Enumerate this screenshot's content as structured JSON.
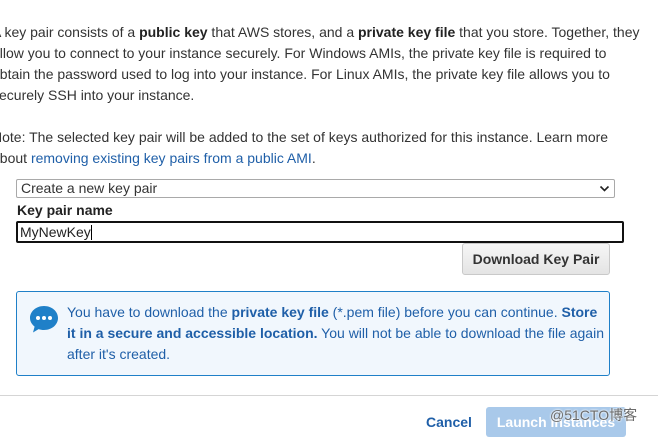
{
  "intro": {
    "l1_a": "A key pair consists of a ",
    "l1_b": "public key",
    "l1_c": " that AWS stores, and a ",
    "l1_d": "private key file",
    "l1_e": " that you store. Together, they",
    "l2": "allow you to connect to your instance securely. For Windows AMIs, the private key file is required to",
    "l3": "obtain the password used to log into your instance. For Linux AMIs, the private key file allows you to",
    "l4": "securely SSH into your instance."
  },
  "note": {
    "l1": "Note: The selected key pair will be added to the set of keys authorized for this instance. Learn more",
    "l2_a": "about ",
    "link": "removing existing key pairs from a public AMI",
    "l2_c": "."
  },
  "key_select": {
    "selected": "Create a new key pair",
    "icon": "chevron-down-icon"
  },
  "key_name": {
    "label": "Key pair name",
    "value": "MyNewKey"
  },
  "download_button": "Download Key Pair",
  "alert": {
    "icon": "speech-bubble-icon",
    "color": "#1f80c8",
    "t1": "You have to download the ",
    "t2": "private key file",
    "t3": " (*.pem file) before you can continue. ",
    "t4": "Store",
    "t5": "it in a secure and accessible location.",
    "t6": " You will not be able to download the file again",
    "t7": "after it's created."
  },
  "footer": {
    "cancel": "Cancel",
    "launch": "Launch Instances"
  },
  "watermark": "@51CTO博客"
}
